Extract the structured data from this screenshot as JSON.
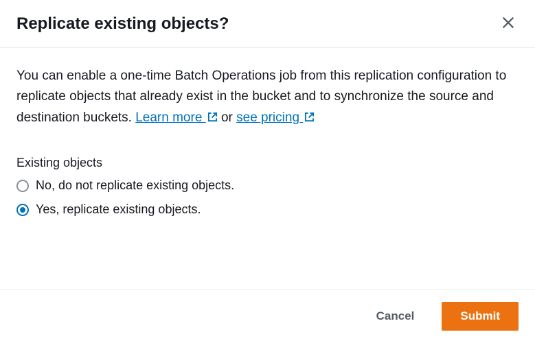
{
  "dialog": {
    "title": "Replicate existing objects?",
    "description_parts": {
      "text1": "You can enable a one-time Batch Operations job from this replication configuration to replicate objects that already exist in the bucket and to synchronize the source and destination buckets. ",
      "learn_more": "Learn more ",
      "text2": " or ",
      "see_pricing": "see pricing "
    },
    "section_label": "Existing objects",
    "options": [
      {
        "label": "No, do not replicate existing objects.",
        "selected": false
      },
      {
        "label": "Yes, replicate existing objects.",
        "selected": true
      }
    ],
    "cancel_label": "Cancel",
    "submit_label": "Submit"
  }
}
